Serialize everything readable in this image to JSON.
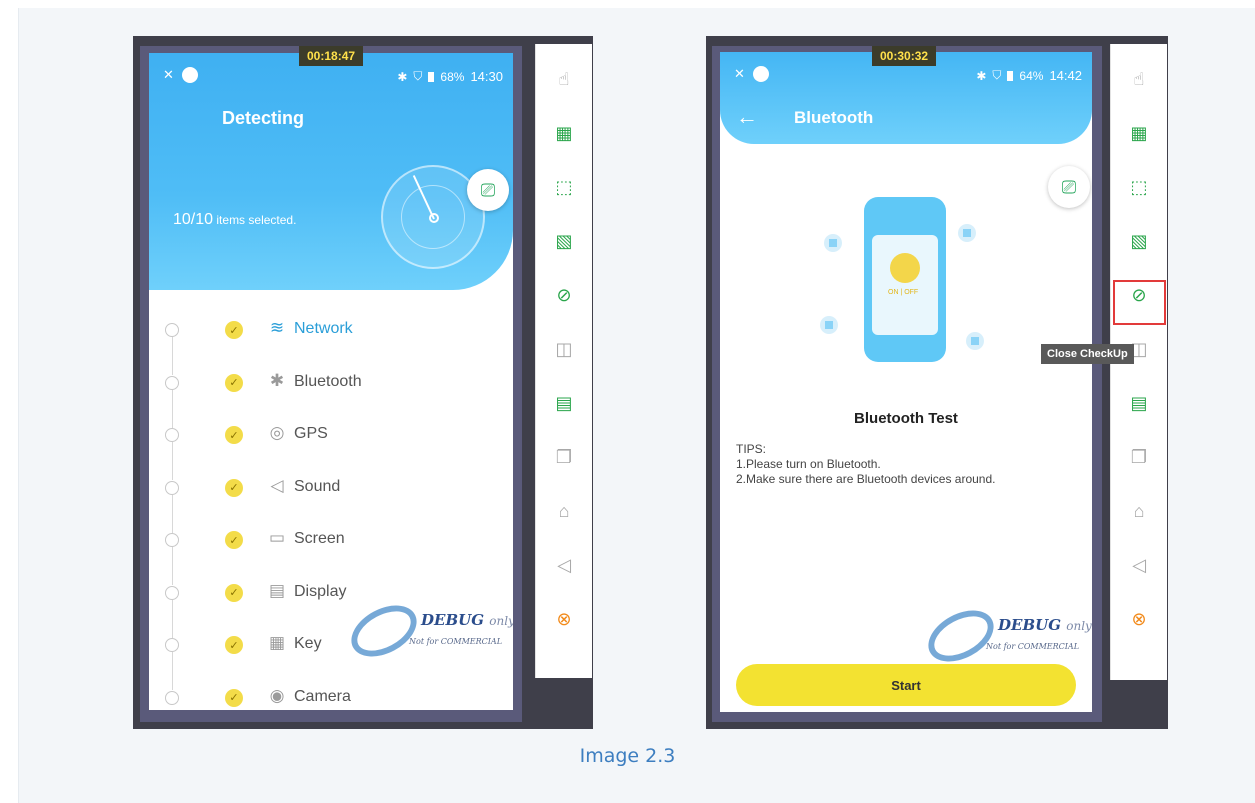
{
  "left": {
    "timer": "00:18:47",
    "status": {
      "battery": "68%",
      "time": "14:30"
    },
    "title": "Detecting",
    "selected_count": "10/10",
    "selected_suffix": "items selected.",
    "items": [
      {
        "label": "Network",
        "icon": "wifi-icon",
        "active": true
      },
      {
        "label": "Bluetooth",
        "icon": "bluetooth-icon",
        "active": false
      },
      {
        "label": "GPS",
        "icon": "gps-icon",
        "active": false
      },
      {
        "label": "Sound",
        "icon": "sound-icon",
        "active": false
      },
      {
        "label": "Screen",
        "icon": "monitor-icon",
        "active": false
      },
      {
        "label": "Display",
        "icon": "display-icon",
        "active": false
      },
      {
        "label": "Key",
        "icon": "keypad-icon",
        "active": false
      },
      {
        "label": "Camera",
        "icon": "camera-icon",
        "active": false
      }
    ]
  },
  "right": {
    "timer": "00:30:32",
    "status": {
      "battery": "64%",
      "time": "14:42"
    },
    "title": "Bluetooth",
    "illustration_label": "ON | OFF",
    "test_title": "Bluetooth Test",
    "tips_heading": "TIPS:",
    "tips": [
      "1.Please turn on Bluetooth.",
      "2.Make sure there are Bluetooth devices around."
    ],
    "start_label": "Start"
  },
  "watermark": {
    "main": "DEBUG",
    "only": "only",
    "sub": "Not for COMMERCIAL"
  },
  "toolbar": {
    "tooltip": "Close CheckUp",
    "icons": [
      "touch-icon",
      "gradient-icon",
      "dotted-frame-icon",
      "stripes-icon",
      "close-checkup-icon",
      "folder-icon",
      "clipboard-icon",
      "recent-apps-icon",
      "home-icon",
      "back-icon",
      "close-circle-icon"
    ]
  },
  "caption": "Image 2.3",
  "colors": {
    "accent_blue": "#3fb0f2",
    "check_yellow": "#f3dc49",
    "toolbar_green": "#2aa54b",
    "close_orange": "#f28a1a",
    "highlight_red": "#e23a3a"
  }
}
